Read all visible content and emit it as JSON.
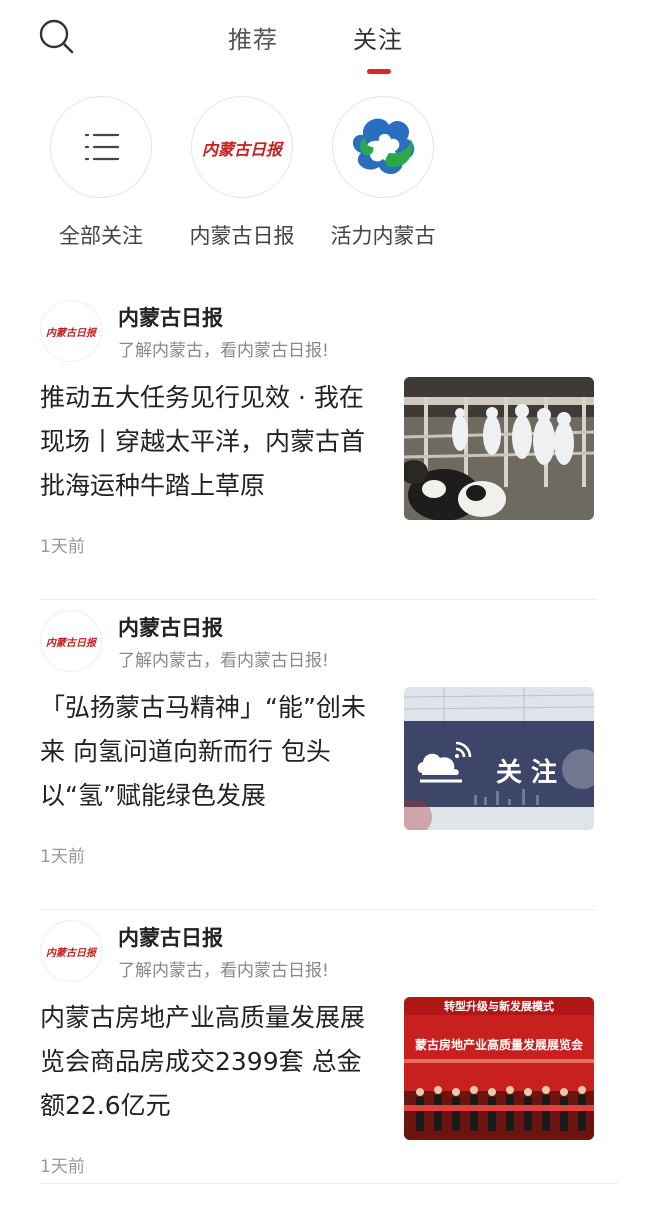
{
  "header": {
    "tabs": [
      {
        "label": "推荐"
      },
      {
        "label": "关注"
      }
    ],
    "active_tab": "关注",
    "accent_color": "#d62a2a"
  },
  "followed_sources": [
    {
      "label": "全部关注",
      "icon": "list-icon"
    },
    {
      "label": "内蒙古日报",
      "logo_text": "内蒙古日报"
    },
    {
      "label": "活力内蒙古",
      "icon": "cloud-logo"
    }
  ],
  "feed": [
    {
      "source_name": "内蒙古日报",
      "source_desc": "了解内蒙古，看内蒙古日报!",
      "logo_text": "内蒙古日报",
      "headline": "推动五大任务见行见效 · 我在现场丨穿越太平洋，内蒙古首批海运种牛踏上草原",
      "time": "1天前"
    },
    {
      "source_name": "内蒙古日报",
      "source_desc": "了解内蒙古，看内蒙古日报!",
      "logo_text": "内蒙古日报",
      "headline": "「弘扬蒙古马精神」“能”创未来 向氢问道向新而行 包头以“氢”赋能绿色发展",
      "time": "1天前",
      "thumb_overlay": "关 注"
    },
    {
      "source_name": "内蒙古日报",
      "source_desc": "了解内蒙古，看内蒙古日报!",
      "logo_text": "内蒙古日报",
      "headline": "内蒙古房地产业高质量发展展览会商品房成交2399套 总金额22.6亿元",
      "time": "1天前",
      "thumb_banner_1": "转型升级与新发展模式",
      "thumb_banner_2": "蒙古房地产业高质量发展展览会"
    }
  ]
}
